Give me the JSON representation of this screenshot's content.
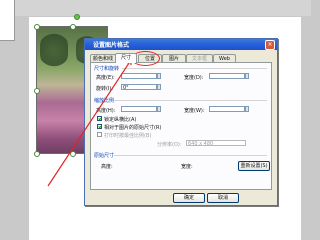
{
  "dialog": {
    "title": "设置图片格式",
    "close_label": "×",
    "tabs": [
      {
        "label": "颜色和线条",
        "active": false,
        "disabled": false
      },
      {
        "label": "尺寸",
        "active": true,
        "disabled": false
      },
      {
        "label": "位置",
        "active": false,
        "disabled": false
      },
      {
        "label": "图片",
        "active": false,
        "disabled": false
      },
      {
        "label": "文本框",
        "active": false,
        "disabled": true
      },
      {
        "label": "Web",
        "active": false,
        "disabled": false
      }
    ],
    "sections": {
      "size_rotate": "尺寸和旋转",
      "scale": "缩放比例",
      "original": "原始尺寸"
    },
    "fields": {
      "height_label": "高度(E):",
      "width_label": "宽度(D):",
      "rotation_label": "旋转(I):",
      "rotation_value": "0°",
      "scale_height_label": "高度(H):",
      "scale_width_label": "宽度(W):"
    },
    "checkboxes": [
      {
        "label": "锁定纵横比(A)",
        "checked": true
      },
      {
        "label": "相对于图片的原始尺寸(R)",
        "checked": true
      },
      {
        "label": "打印时按最佳比例(B)",
        "checked": false
      }
    ],
    "resolution": {
      "label": "分辨率(O):",
      "value": "640 x 480"
    },
    "original_size": {
      "height_label": "高度:",
      "width_label": "宽度:"
    },
    "buttons": {
      "reset": "重新设置(S)",
      "ok": "确定",
      "cancel": "取消"
    }
  },
  "colors": {
    "annotation": "#e02424",
    "titlebar": "#245edb"
  }
}
